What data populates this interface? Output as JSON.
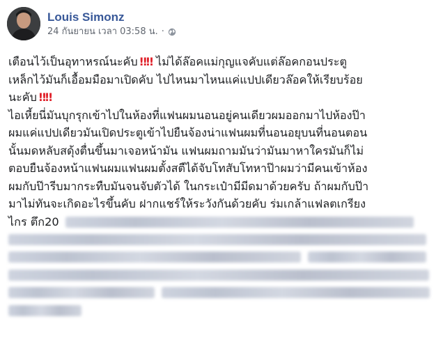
{
  "post": {
    "author": "Louis Simonz",
    "date": "24 กันยายน เวลา 03:58 น.",
    "separator": "·",
    "privacy_icon": "globe-icon",
    "lines": [
      "เตือนไว้เป็นอุทาหรณ์นะคับ",
      "ไม่ได้ล๊อคแม่กุญแจคับแต่ล๊อคกอนประตู",
      "เหล็กไว้มันก็เอื้อมมือมาเปิดคับ ไปไหนมาไหนแค่แปปเดียวล๊อคให้เรียบร้อย",
      "นะคับ",
      "ไอเหี้ยนี่มันบุกรุกเข้าไปในห้องที่แฟนผมนอนอยู่คนเดียวผมออกมาไปห้องป๊า",
      "ผมแค่แปปเดียวมันเปิดประตูเข้าไปยืนจ้องน่าแฟนผมที่นอนอยุบนที่นอนตอน",
      "นั้นมดหลับสดุ้งตื่นขึ้นมาเจอหน้ามัน แฟนผมถามมันว่ามันมาหาใครมันก็ไม่",
      "ตอบยืนจ้องหน้าแฟนผมแฟนผมตั้งสตืได้จับโทสับโทหาป๊าผมว่ามีคนเข้าห้อง",
      "ผมกับป๊ารีบมากระทืบมันจนจับตัวได้ ในกระเป๋ามีมีดมาด้วยครับ ถ้าผมกับป๊า",
      "มาไม่ทันจะเกิดอะไรขึ้นคับ ฝากแชร์ให้ระวังกันด้วยคับ ร่มเกล้าแฟลตเกรียง",
      "ไกร ตึก20"
    ],
    "emoji_bangs": "‼‼"
  },
  "colors": {
    "author": "#385898",
    "meta": "#616770",
    "text": "#1c1e21",
    "emoji": "#e0212a"
  }
}
